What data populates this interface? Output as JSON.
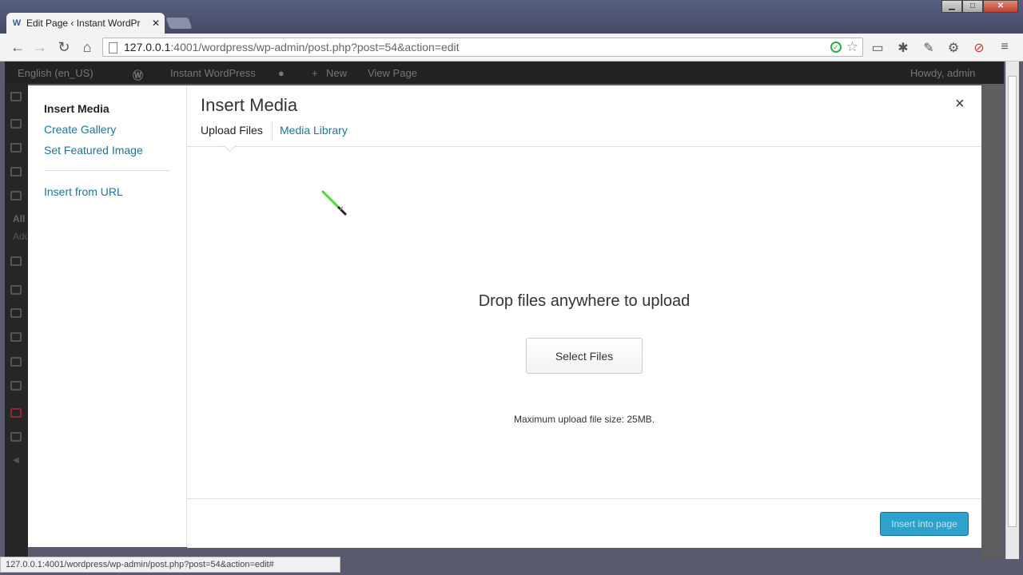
{
  "browser": {
    "tab_title": "Edit Page ‹ Instant WordPr",
    "url_host": "127.0.0.1",
    "url_path": ":4001/wordpress/wp-admin/post.php?post=54&action=edit",
    "status_url": "127.0.0.1:4001/wordpress/wp-admin/post.php?post=54&action=edit#",
    "tab_favicon": "wordpress-favicon-icon",
    "nav_icons": [
      "back-arrow-icon",
      "forward-arrow-icon",
      "reload-icon",
      "home-icon"
    ],
    "extension_icons": [
      "ruler-icon",
      "bug-icon",
      "eyedropper-icon",
      "gear-icon",
      "stop-icon",
      "menu-icon"
    ]
  },
  "adminbar": {
    "language": "English (en_US)",
    "site_name": "Instant WordPress",
    "new_label": "New",
    "view_page": "View Page",
    "howdy": "Howdy, admin"
  },
  "wp_sidebar": {
    "all": "All",
    "add": "Add"
  },
  "media_modal": {
    "menu": {
      "insert_media": "Insert Media",
      "create_gallery": "Create Gallery",
      "set_featured_image": "Set Featured Image",
      "insert_from_url": "Insert from URL"
    },
    "title": "Insert Media",
    "close_symbol": "×",
    "tabs": {
      "upload_files": "Upload Files",
      "media_library": "Media Library"
    },
    "drop_title": "Drop files anywhere to upload",
    "select_files": "Select Files",
    "max_upload": "Maximum upload file size: 25MB.",
    "insert_button": "Insert into page"
  },
  "colors": {
    "link": "#21759b",
    "primary_button": "#2ea2cc",
    "admin_bar": "#222222"
  }
}
